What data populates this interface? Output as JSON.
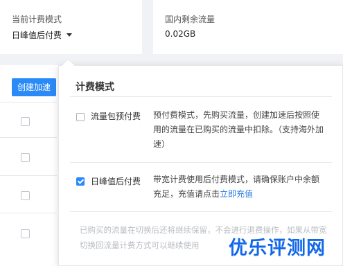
{
  "billing_card": {
    "label": "当前计费模式",
    "value": "日峰值后付费"
  },
  "traffic_card": {
    "label": "国内剩余流量",
    "value": "0.02GB"
  },
  "toolbar": {
    "create_label": "创建加速"
  },
  "popover": {
    "title": "计费模式",
    "options": [
      {
        "label": "流量包预付费",
        "checked": false,
        "description": "预付费模式，先购买流量，创建加速后按照使用的流量在已购买的流量中扣除。（支持海外加速）"
      },
      {
        "label": "日峰值后付费",
        "checked": true,
        "description_prefix": "带宽计费使用后付费模式，请确保账户中余额充足，充值请点击",
        "description_link": "立即充值"
      }
    ],
    "footer_note": "已购买的流量在切换后还将继续保留，不会进行退费操作，如果从带宽切换回流量计费方式可以继续使用"
  },
  "watermark": {
    "text": "优乐评测网"
  },
  "colors": {
    "accent": "#2a8af7",
    "link": "#2a7be0",
    "watermark": "#1268e8"
  }
}
